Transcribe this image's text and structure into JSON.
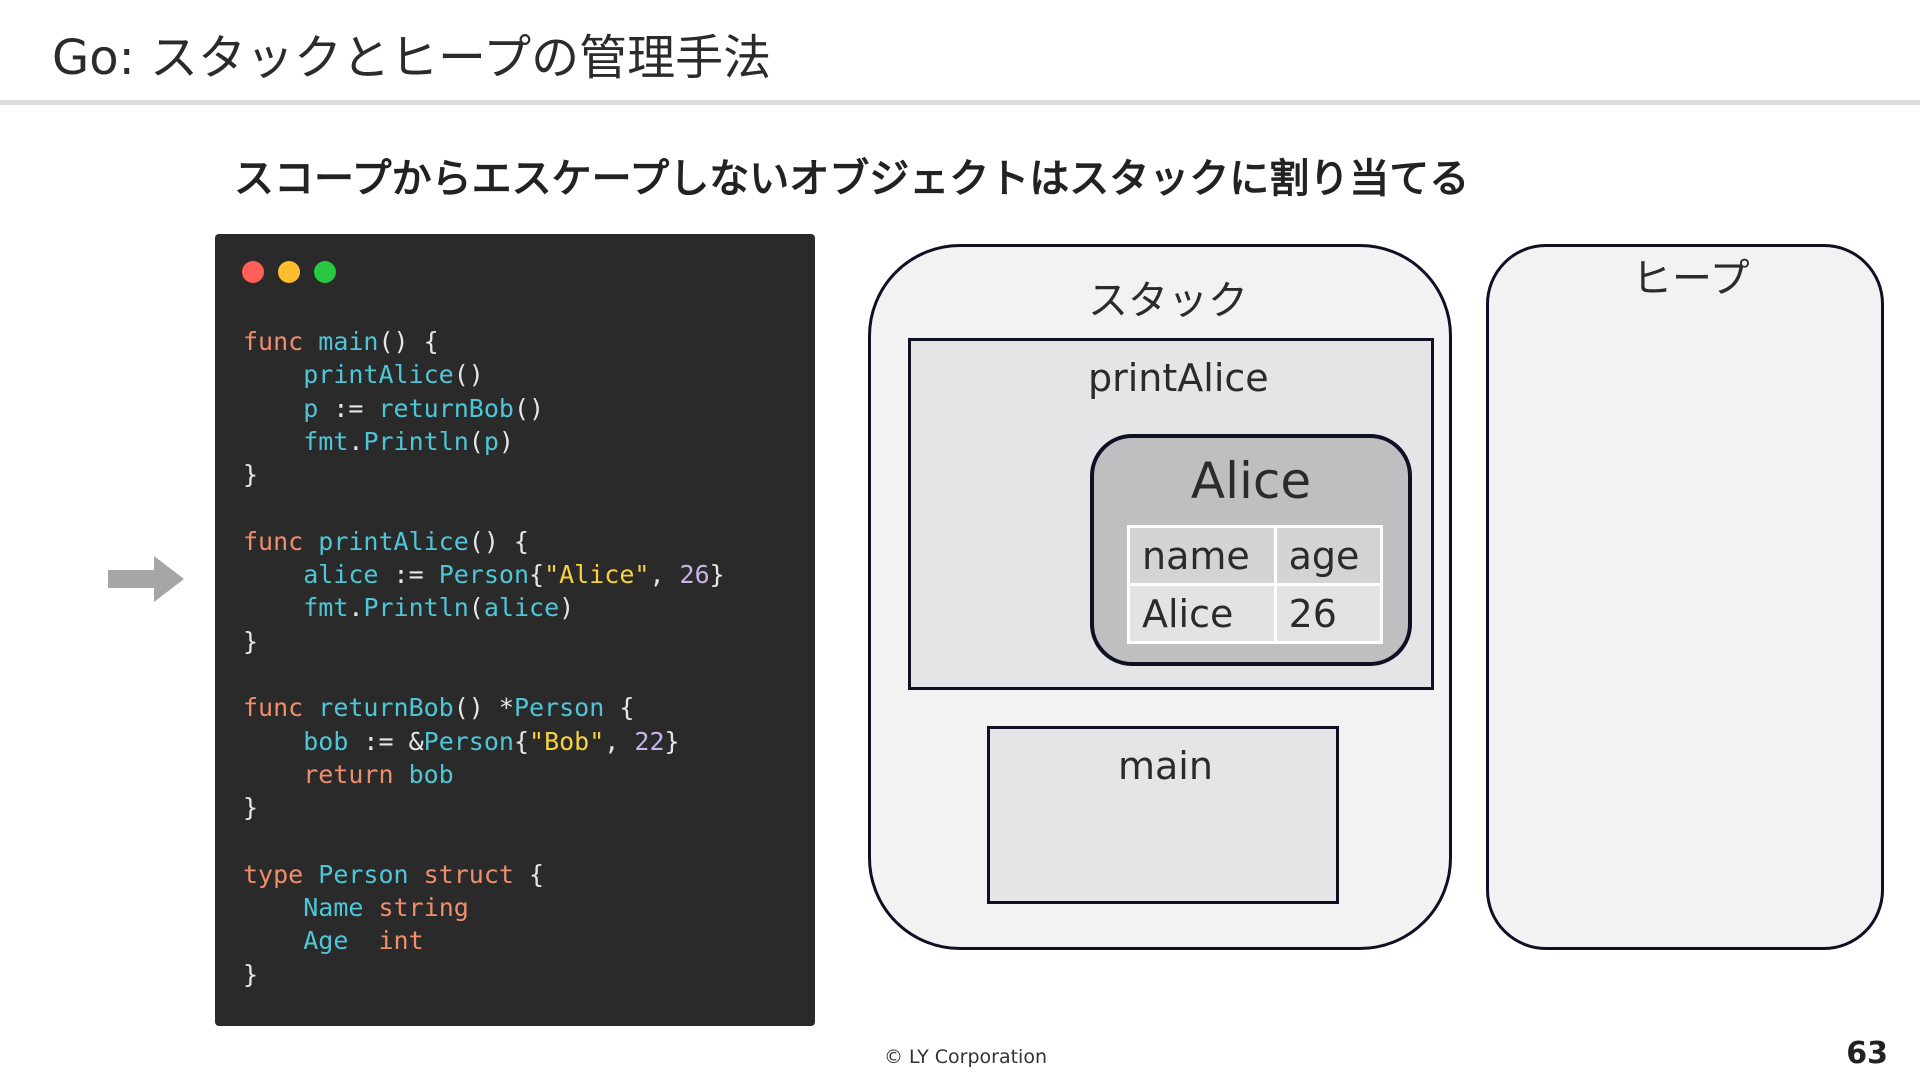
{
  "slide": {
    "title": "Go: スタックとヒープの管理手法",
    "subtitle": "スコープからエスケープしないオブジェクトはスタックに割り当てる",
    "footer": "© LY Corporation",
    "page_number": "63"
  },
  "code_window": {
    "dots": [
      "#ff5f57",
      "#febc2e",
      "#28c840"
    ],
    "lines": [
      [
        [
          "kw",
          "func "
        ],
        [
          "fn",
          "main"
        ],
        [
          "pn",
          "() {"
        ]
      ],
      [
        [
          "pn",
          "    "
        ],
        [
          "fn",
          "printAlice"
        ],
        [
          "pn",
          "()"
        ]
      ],
      [
        [
          "pn",
          "    "
        ],
        [
          "fn",
          "p"
        ],
        [
          "pn",
          " := "
        ],
        [
          "fn",
          "returnBob"
        ],
        [
          "pn",
          "()"
        ]
      ],
      [
        [
          "pn",
          "    "
        ],
        [
          "fn",
          "fmt"
        ],
        [
          "pn",
          "."
        ],
        [
          "fn",
          "Println"
        ],
        [
          "pn",
          "("
        ],
        [
          "fn",
          "p"
        ],
        [
          "pn",
          ")"
        ]
      ],
      [
        [
          "pn",
          "}"
        ]
      ],
      [
        [
          "pn",
          ""
        ]
      ],
      [
        [
          "kw",
          "func "
        ],
        [
          "fn",
          "printAlice"
        ],
        [
          "pn",
          "() {"
        ]
      ],
      [
        [
          "pn",
          "    "
        ],
        [
          "fn",
          "alice"
        ],
        [
          "pn",
          " := "
        ],
        [
          "fn",
          "Person"
        ],
        [
          "pn",
          "{"
        ],
        [
          "st",
          "\"Alice\""
        ],
        [
          "pn",
          ", "
        ],
        [
          "nm",
          "26"
        ],
        [
          "pn",
          "}"
        ]
      ],
      [
        [
          "pn",
          "    "
        ],
        [
          "fn",
          "fmt"
        ],
        [
          "pn",
          "."
        ],
        [
          "fn",
          "Println"
        ],
        [
          "pn",
          "("
        ],
        [
          "fn",
          "alice"
        ],
        [
          "pn",
          ")"
        ]
      ],
      [
        [
          "pn",
          "}"
        ]
      ],
      [
        [
          "pn",
          ""
        ]
      ],
      [
        [
          "kw",
          "func "
        ],
        [
          "fn",
          "returnBob"
        ],
        [
          "pn",
          "() *"
        ],
        [
          "fn",
          "Person"
        ],
        [
          "pn",
          " {"
        ]
      ],
      [
        [
          "pn",
          "    "
        ],
        [
          "fn",
          "bob"
        ],
        [
          "pn",
          " := &"
        ],
        [
          "fn",
          "Person"
        ],
        [
          "pn",
          "{"
        ],
        [
          "st",
          "\"Bob\""
        ],
        [
          "pn",
          ", "
        ],
        [
          "nm",
          "22"
        ],
        [
          "pn",
          "}"
        ]
      ],
      [
        [
          "pn",
          "    "
        ],
        [
          "kw",
          "return "
        ],
        [
          "fn",
          "bob"
        ]
      ],
      [
        [
          "pn",
          "}"
        ]
      ],
      [
        [
          "pn",
          ""
        ]
      ],
      [
        [
          "kw",
          "type "
        ],
        [
          "fn",
          "Person "
        ],
        [
          "kw",
          "struct"
        ],
        [
          "pn",
          " {"
        ]
      ],
      [
        [
          "pn",
          "    "
        ],
        [
          "fn",
          "Name "
        ],
        [
          "kw",
          "string"
        ]
      ],
      [
        [
          "pn",
          "    "
        ],
        [
          "fn",
          "Age  "
        ],
        [
          "kw",
          "int"
        ]
      ],
      [
        [
          "pn",
          "}"
        ]
      ]
    ]
  },
  "diagram": {
    "stack_label": "スタック",
    "heap_label": "ヒープ",
    "frames": {
      "printAlice": "printAlice",
      "main": "main"
    },
    "object": {
      "title": "Alice",
      "headers": [
        "name",
        "age"
      ],
      "values": [
        "Alice",
        "26"
      ]
    }
  },
  "colors": {
    "code_bg": "#2a2a2b",
    "keyword": "#f08d6b",
    "identifier": "#4fc6d6",
    "string": "#f6d23c",
    "number": "#c9b2e8",
    "border": "#101025"
  }
}
